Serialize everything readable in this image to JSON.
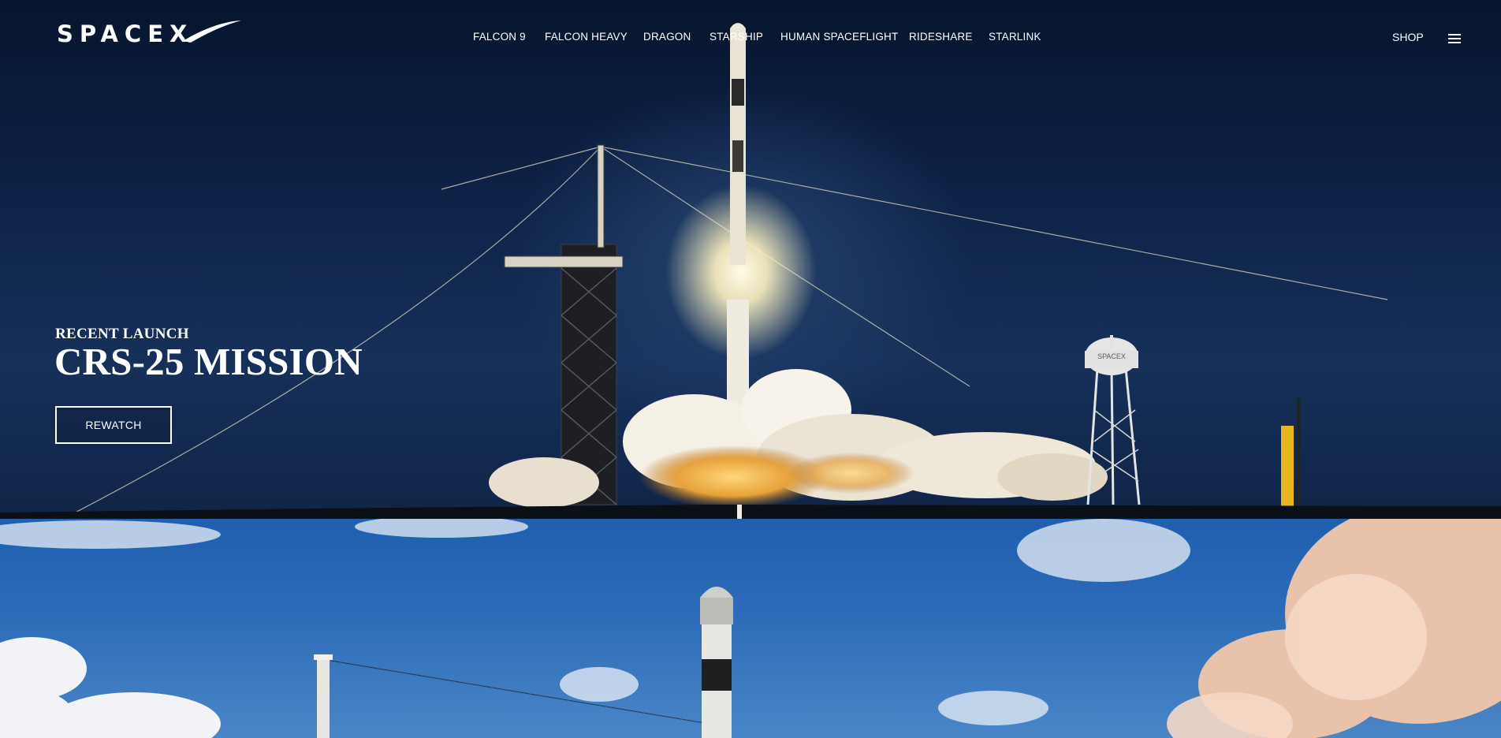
{
  "brand": {
    "logo_text": "SPACEX"
  },
  "nav": {
    "items": [
      {
        "label": "FALCON 9"
      },
      {
        "label": "FALCON HEAVY"
      },
      {
        "label": "DRAGON"
      },
      {
        "label": "STARSHIP"
      },
      {
        "label": "HUMAN SPACEFLIGHT"
      },
      {
        "label": "RIDESHARE"
      },
      {
        "label": "STARLINK"
      }
    ],
    "shop_label": "SHOP",
    "menu_icon": "hamburger-menu-icon"
  },
  "hero": {
    "kicker": "RECENT LAUNCH",
    "title": "CRS-25 MISSION",
    "cta_label": "REWATCH",
    "water_tower_text": "SPACEX"
  },
  "colors": {
    "text": "#ffffff",
    "night_sky": "#0c1f42",
    "day_sky": "#2d6cb8"
  }
}
